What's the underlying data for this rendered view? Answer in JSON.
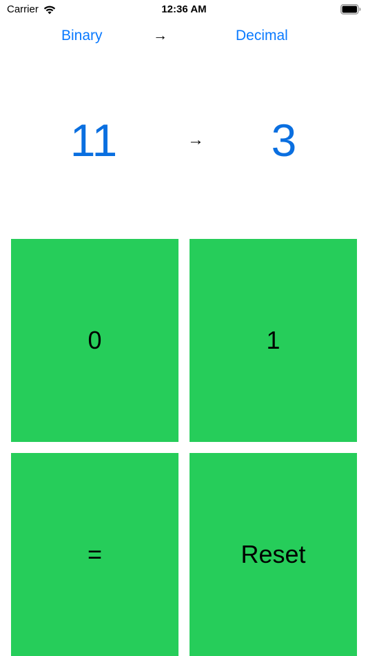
{
  "status_bar": {
    "carrier": "Carrier",
    "time": "12:36 AM",
    "icons": [
      "wifi-icon",
      "battery-icon"
    ]
  },
  "mode": {
    "from_label": "Binary",
    "arrow": "→",
    "to_label": "Decimal"
  },
  "display": {
    "input_value": "11",
    "arrow": "→",
    "output_value": "3"
  },
  "keypad": {
    "zero_label": "0",
    "one_label": "1",
    "equals_label": "=",
    "reset_label": "Reset"
  },
  "colors": {
    "accent": "#0a7aff",
    "key_background": "#26cd5a",
    "text": "#000000"
  }
}
